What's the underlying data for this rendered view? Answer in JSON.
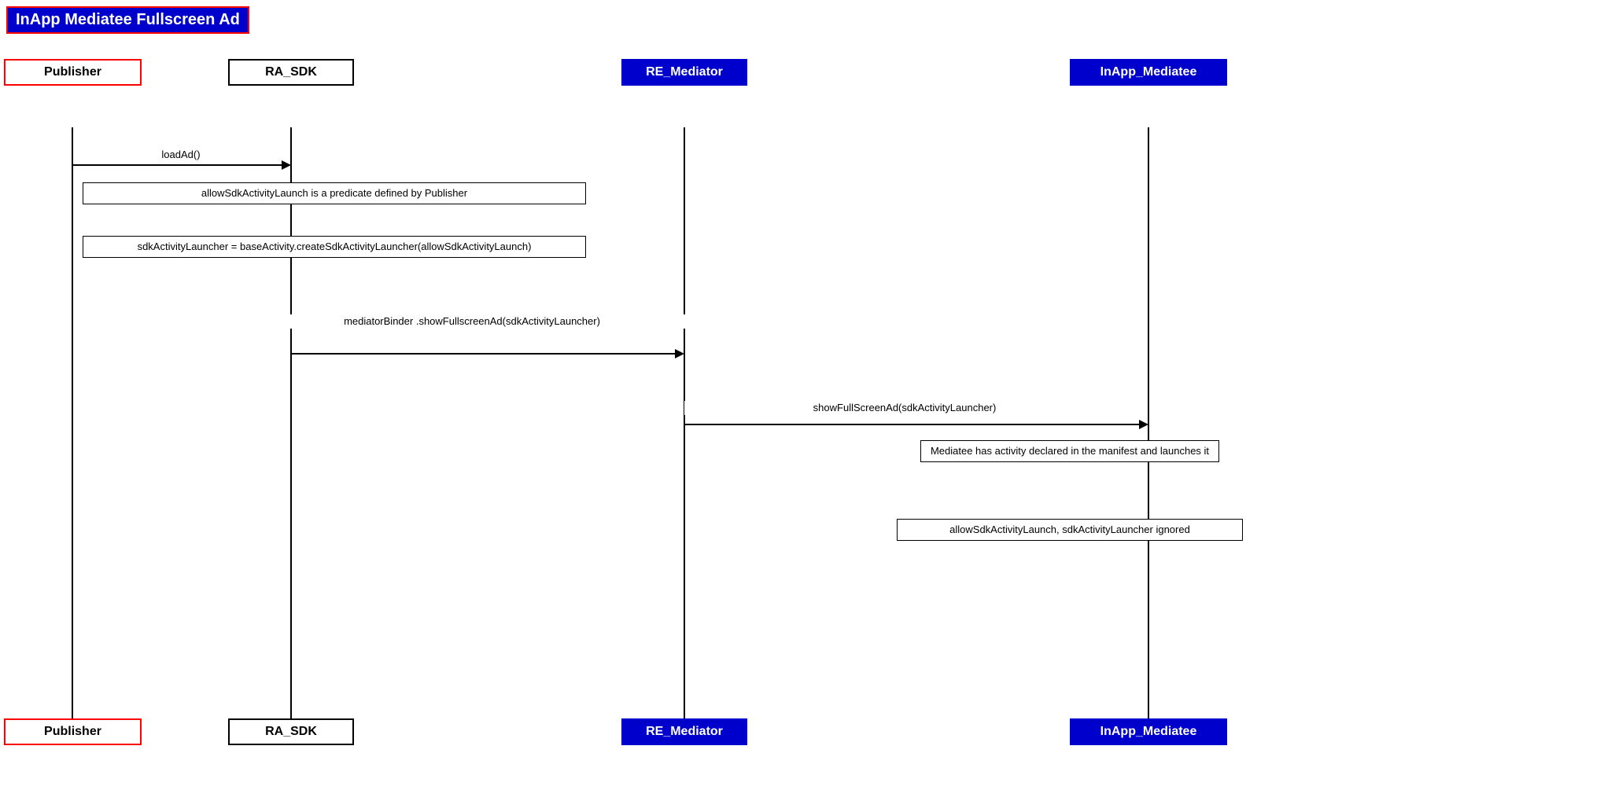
{
  "title": "InApp Mediatee Fullscreen Ad",
  "actors": {
    "publisher_top": {
      "label": "Publisher",
      "style": "red"
    },
    "ra_sdk_top": {
      "label": "RA_SDK",
      "style": "white"
    },
    "re_mediator_top": {
      "label": "RE_Mediator",
      "style": "blue"
    },
    "inapp_mediatee_top": {
      "label": "InApp_Mediatee",
      "style": "blue"
    },
    "publisher_bot": {
      "label": "Publisher",
      "style": "red"
    },
    "ra_sdk_bot": {
      "label": "RA_SDK",
      "style": "white"
    },
    "re_mediator_bot": {
      "label": "RE_Mediator",
      "style": "blue"
    },
    "inapp_mediatee_bot": {
      "label": "InApp_Mediatee",
      "style": "blue"
    }
  },
  "messages": {
    "loadAd": "loadAd()",
    "allowSdkNote": "allowSdkActivityLaunch is a predicate defined by Publisher",
    "sdkActivityLauncher": "sdkActivityLauncher =\nbaseActivity.createSdkActivityLauncher(allowSdkActivityLaunch)",
    "mediatorBinder": "mediatorBinder\n.showFullscreenAd(sdkActivityLauncher)",
    "showFullScreenAd": "showFullScreenAd(sdkActivityLauncher)",
    "mediateeActivity": "Mediatee has activity declared\nin the manifest and launches it",
    "allowSdkIgnored": "allowSdkActivityLaunch, sdkActivityLauncher\nignored"
  }
}
